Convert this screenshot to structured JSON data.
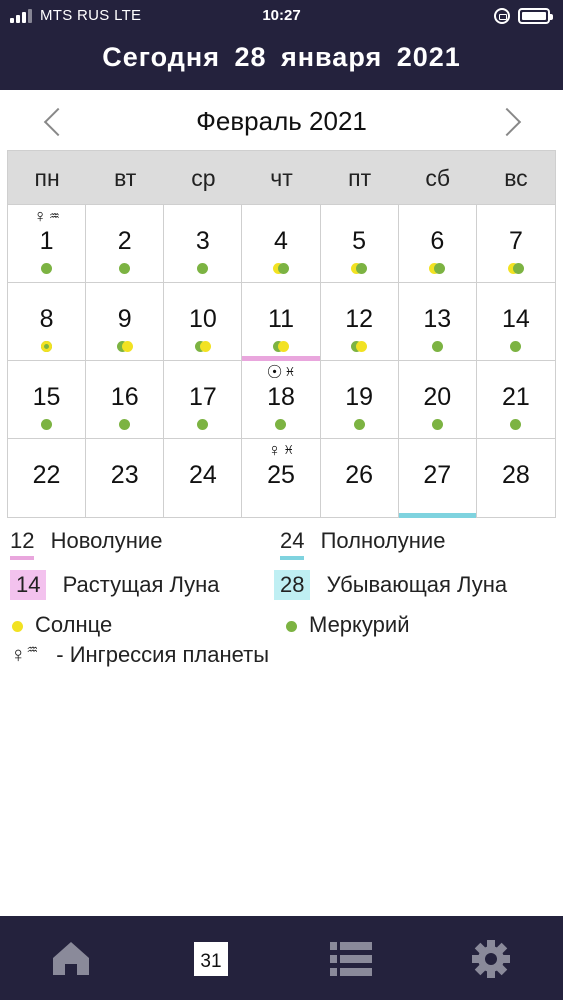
{
  "status": {
    "carrier": "MTS RUS  LTE",
    "time": "10:27"
  },
  "header": {
    "today": "Сегодня 28 января 2021"
  },
  "nav": {
    "month": "Февраль 2021",
    "prev_icon": "chevron-left-icon",
    "next_icon": "chevron-right-icon"
  },
  "weekdays": [
    "пн",
    "вт",
    "ср",
    "чт",
    "пт",
    "сб",
    "вс"
  ],
  "days": [
    {
      "d": "1",
      "glyph": "♀",
      "sign": "♒",
      "dots": [
        "g"
      ]
    },
    {
      "d": "2",
      "dots": [
        "g"
      ]
    },
    {
      "d": "3",
      "dots": [
        "g"
      ]
    },
    {
      "d": "4",
      "dots": [
        "y",
        "g"
      ]
    },
    {
      "d": "5",
      "dots": [
        "y",
        "g"
      ]
    },
    {
      "d": "6",
      "dots": [
        "y",
        "g"
      ]
    },
    {
      "d": "7",
      "dots": [
        "y",
        "g"
      ]
    },
    {
      "d": "8",
      "dots": [
        "yg"
      ]
    },
    {
      "d": "9",
      "dots": [
        "g",
        "y"
      ]
    },
    {
      "d": "10",
      "dots": [
        "g",
        "y"
      ]
    },
    {
      "d": "11",
      "dots": [
        "g",
        "y"
      ],
      "bar": "pink"
    },
    {
      "d": "12",
      "dots": [
        "g",
        "y"
      ]
    },
    {
      "d": "13",
      "dots": [
        "g"
      ]
    },
    {
      "d": "14",
      "dots": [
        "g"
      ]
    },
    {
      "d": "15",
      "dots": [
        "g"
      ]
    },
    {
      "d": "16",
      "dots": [
        "g"
      ]
    },
    {
      "d": "17",
      "dots": [
        "g"
      ]
    },
    {
      "d": "18",
      "glyph": "☉",
      "sign": "♓",
      "dots": [
        "g"
      ]
    },
    {
      "d": "19",
      "dots": [
        "g"
      ]
    },
    {
      "d": "20",
      "dots": [
        "g"
      ]
    },
    {
      "d": "21",
      "dots": [
        "g"
      ]
    },
    {
      "d": "22"
    },
    {
      "d": "23"
    },
    {
      "d": "24"
    },
    {
      "d": "25",
      "glyph": "♀",
      "sign": "♓"
    },
    {
      "d": "26"
    },
    {
      "d": "27",
      "bar": "cyan"
    },
    {
      "d": "28"
    }
  ],
  "legend": {
    "new_moon_num": "12",
    "new_moon": "Новолуние",
    "full_moon_num": "24",
    "full_moon": "Полнолуние",
    "waxing_num": "14",
    "waxing": "Растущая Луна",
    "waning_num": "28",
    "waning": "Убывающая Луна",
    "sun": "Солнце",
    "mercury": "Меркурий",
    "ingress_glyph": "♀",
    "ingress_sign": "♒",
    "ingress": "-  Ингрессия  планеты"
  },
  "tabbar": {
    "calendar_day": "31",
    "icons": [
      "home-icon",
      "calendar-icon",
      "list-icon",
      "gear-icon"
    ]
  },
  "colors": {
    "header_bg": "#24223d",
    "pink": "#e9a6dd",
    "pink_bg": "#f3c2ee",
    "cyan": "#7fd3df",
    "cyan_bg": "#bfeff3",
    "sun": "#f2e222",
    "mercury": "#7cb342",
    "grid_head": "#dcdcdc"
  }
}
